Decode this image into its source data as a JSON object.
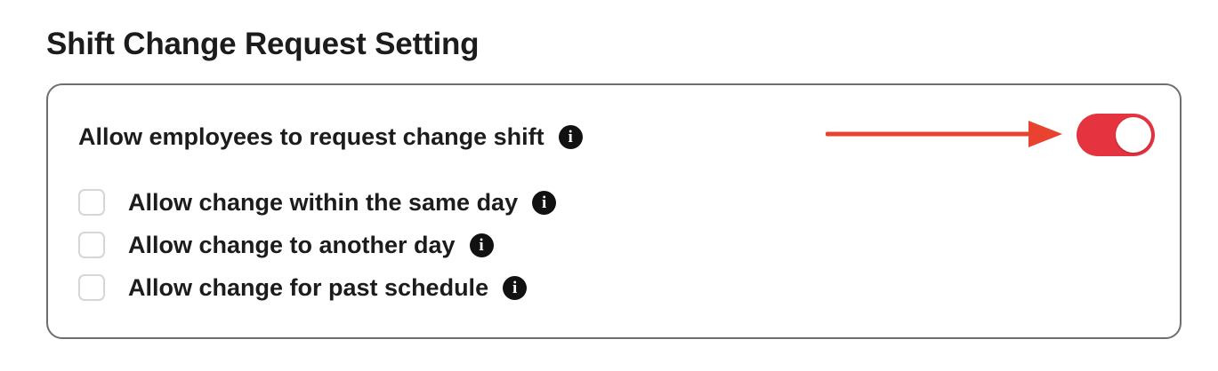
{
  "section": {
    "title": "Shift Change Request Setting"
  },
  "main_setting": {
    "label": "Allow employees to request change shift",
    "info_icon": "i",
    "toggle_on": true,
    "toggle_color": "#e53340"
  },
  "annotation": {
    "arrow_color": "#e8432f"
  },
  "options": [
    {
      "label": "Allow change within the same day",
      "checked": false,
      "info_icon": "i"
    },
    {
      "label": "Allow change to another day",
      "checked": false,
      "info_icon": "i"
    },
    {
      "label": "Allow change for past schedule",
      "checked": false,
      "info_icon": "i"
    }
  ]
}
